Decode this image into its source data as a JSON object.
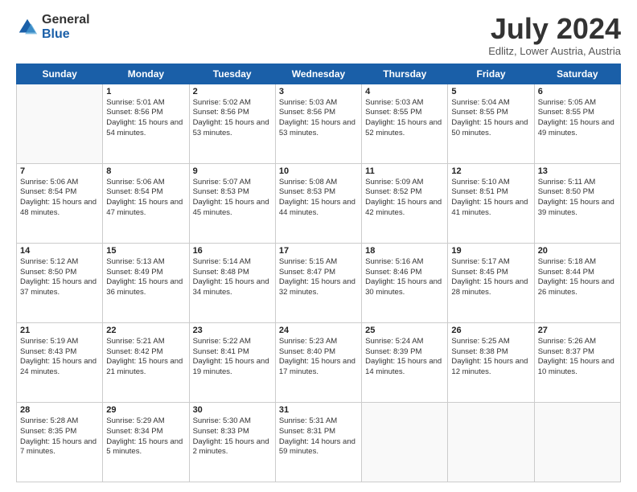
{
  "header": {
    "logo_general": "General",
    "logo_blue": "Blue",
    "month_title": "July 2024",
    "location": "Edlitz, Lower Austria, Austria"
  },
  "weekdays": [
    "Sunday",
    "Monday",
    "Tuesday",
    "Wednesday",
    "Thursday",
    "Friday",
    "Saturday"
  ],
  "weeks": [
    [
      {
        "day": "",
        "empty": true
      },
      {
        "day": "1",
        "sunrise": "5:01 AM",
        "sunset": "8:56 PM",
        "daylight": "15 hours and 54 minutes."
      },
      {
        "day": "2",
        "sunrise": "5:02 AM",
        "sunset": "8:56 PM",
        "daylight": "15 hours and 53 minutes."
      },
      {
        "day": "3",
        "sunrise": "5:03 AM",
        "sunset": "8:56 PM",
        "daylight": "15 hours and 53 minutes."
      },
      {
        "day": "4",
        "sunrise": "5:03 AM",
        "sunset": "8:55 PM",
        "daylight": "15 hours and 52 minutes."
      },
      {
        "day": "5",
        "sunrise": "5:04 AM",
        "sunset": "8:55 PM",
        "daylight": "15 hours and 50 minutes."
      },
      {
        "day": "6",
        "sunrise": "5:05 AM",
        "sunset": "8:55 PM",
        "daylight": "15 hours and 49 minutes."
      }
    ],
    [
      {
        "day": "7",
        "sunrise": "5:06 AM",
        "sunset": "8:54 PM",
        "daylight": "15 hours and 48 minutes."
      },
      {
        "day": "8",
        "sunrise": "5:06 AM",
        "sunset": "8:54 PM",
        "daylight": "15 hours and 47 minutes."
      },
      {
        "day": "9",
        "sunrise": "5:07 AM",
        "sunset": "8:53 PM",
        "daylight": "15 hours and 45 minutes."
      },
      {
        "day": "10",
        "sunrise": "5:08 AM",
        "sunset": "8:53 PM",
        "daylight": "15 hours and 44 minutes."
      },
      {
        "day": "11",
        "sunrise": "5:09 AM",
        "sunset": "8:52 PM",
        "daylight": "15 hours and 42 minutes."
      },
      {
        "day": "12",
        "sunrise": "5:10 AM",
        "sunset": "8:51 PM",
        "daylight": "15 hours and 41 minutes."
      },
      {
        "day": "13",
        "sunrise": "5:11 AM",
        "sunset": "8:50 PM",
        "daylight": "15 hours and 39 minutes."
      }
    ],
    [
      {
        "day": "14",
        "sunrise": "5:12 AM",
        "sunset": "8:50 PM",
        "daylight": "15 hours and 37 minutes."
      },
      {
        "day": "15",
        "sunrise": "5:13 AM",
        "sunset": "8:49 PM",
        "daylight": "15 hours and 36 minutes."
      },
      {
        "day": "16",
        "sunrise": "5:14 AM",
        "sunset": "8:48 PM",
        "daylight": "15 hours and 34 minutes."
      },
      {
        "day": "17",
        "sunrise": "5:15 AM",
        "sunset": "8:47 PM",
        "daylight": "15 hours and 32 minutes."
      },
      {
        "day": "18",
        "sunrise": "5:16 AM",
        "sunset": "8:46 PM",
        "daylight": "15 hours and 30 minutes."
      },
      {
        "day": "19",
        "sunrise": "5:17 AM",
        "sunset": "8:45 PM",
        "daylight": "15 hours and 28 minutes."
      },
      {
        "day": "20",
        "sunrise": "5:18 AM",
        "sunset": "8:44 PM",
        "daylight": "15 hours and 26 minutes."
      }
    ],
    [
      {
        "day": "21",
        "sunrise": "5:19 AM",
        "sunset": "8:43 PM",
        "daylight": "15 hours and 24 minutes."
      },
      {
        "day": "22",
        "sunrise": "5:21 AM",
        "sunset": "8:42 PM",
        "daylight": "15 hours and 21 minutes."
      },
      {
        "day": "23",
        "sunrise": "5:22 AM",
        "sunset": "8:41 PM",
        "daylight": "15 hours and 19 minutes."
      },
      {
        "day": "24",
        "sunrise": "5:23 AM",
        "sunset": "8:40 PM",
        "daylight": "15 hours and 17 minutes."
      },
      {
        "day": "25",
        "sunrise": "5:24 AM",
        "sunset": "8:39 PM",
        "daylight": "15 hours and 14 minutes."
      },
      {
        "day": "26",
        "sunrise": "5:25 AM",
        "sunset": "8:38 PM",
        "daylight": "15 hours and 12 minutes."
      },
      {
        "day": "27",
        "sunrise": "5:26 AM",
        "sunset": "8:37 PM",
        "daylight": "15 hours and 10 minutes."
      }
    ],
    [
      {
        "day": "28",
        "sunrise": "5:28 AM",
        "sunset": "8:35 PM",
        "daylight": "15 hours and 7 minutes."
      },
      {
        "day": "29",
        "sunrise": "5:29 AM",
        "sunset": "8:34 PM",
        "daylight": "15 hours and 5 minutes."
      },
      {
        "day": "30",
        "sunrise": "5:30 AM",
        "sunset": "8:33 PM",
        "daylight": "15 hours and 2 minutes."
      },
      {
        "day": "31",
        "sunrise": "5:31 AM",
        "sunset": "8:31 PM",
        "daylight": "14 hours and 59 minutes."
      },
      {
        "day": "",
        "empty": true
      },
      {
        "day": "",
        "empty": true
      },
      {
        "day": "",
        "empty": true
      }
    ]
  ]
}
